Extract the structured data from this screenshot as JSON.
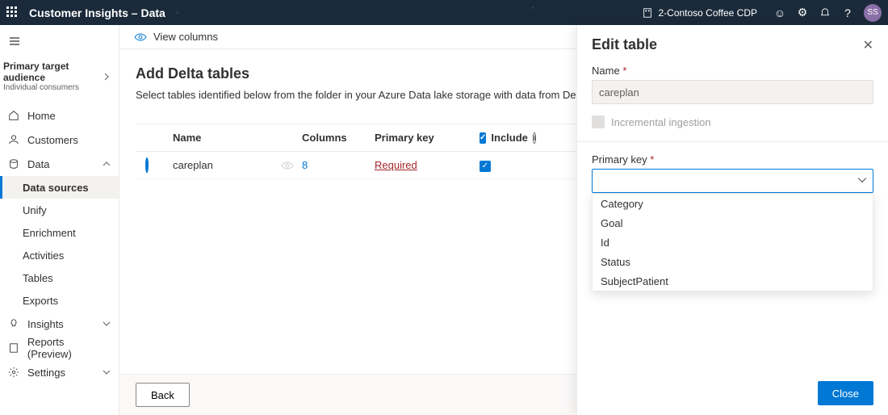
{
  "topbar": {
    "title": "Customer Insights – Data",
    "environment": "2-Contoso Coffee CDP",
    "avatar": "SS"
  },
  "audience": {
    "label": "Primary target audience",
    "value": "Individual consumers"
  },
  "nav": {
    "home": "Home",
    "customers": "Customers",
    "data": "Data",
    "data_sources": "Data sources",
    "unify": "Unify",
    "enrichment": "Enrichment",
    "activities": "Activities",
    "tables": "Tables",
    "exports": "Exports",
    "insights": "Insights",
    "reports": "Reports (Preview)",
    "settings": "Settings"
  },
  "toolbar": {
    "view_columns": "View columns"
  },
  "page": {
    "title": "Add Delta tables",
    "subtitle": "Select tables identified below from the folder in your Azure Data lake storage with data from Delta tables."
  },
  "table": {
    "headers": {
      "name": "Name",
      "columns": "Columns",
      "primary_key": "Primary key",
      "include": "Include"
    },
    "rows": [
      {
        "name": "careplan",
        "columns": "8",
        "primary_key": "Required"
      }
    ]
  },
  "footer": {
    "back": "Back"
  },
  "panel": {
    "title": "Edit table",
    "name_label": "Name",
    "name_value": "careplan",
    "incremental": "Incremental ingestion",
    "pk_label": "Primary key",
    "options": [
      "Category",
      "Goal",
      "Id",
      "Status",
      "SubjectPatient"
    ],
    "close": "Close"
  }
}
